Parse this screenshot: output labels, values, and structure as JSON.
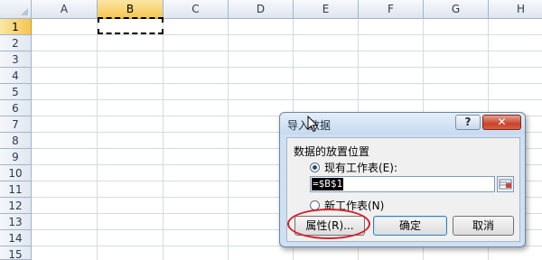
{
  "sheet": {
    "columns": [
      "A",
      "B",
      "C",
      "D",
      "E",
      "F",
      "G",
      "H"
    ],
    "rows": [
      "1",
      "2",
      "3",
      "4",
      "5",
      "6",
      "7",
      "8",
      "9",
      "10",
      "11",
      "12",
      "13",
      "14",
      "15"
    ],
    "selected_column": "B",
    "selected_row": "1"
  },
  "dialog": {
    "title": "导入数据",
    "help_label": "?",
    "close_label": "✕",
    "group_label": "数据的放置位置",
    "option_existing": "现有工作表(E):",
    "option_new": "新工作表(N)",
    "range_value": "=$B$1",
    "btn_properties": "属性(R)...",
    "btn_ok": "确定",
    "btn_cancel": "取消"
  },
  "colors": {
    "header_selected": "#f5c64f",
    "annotation_red": "#d2222a",
    "close_red": "#c7442c"
  }
}
